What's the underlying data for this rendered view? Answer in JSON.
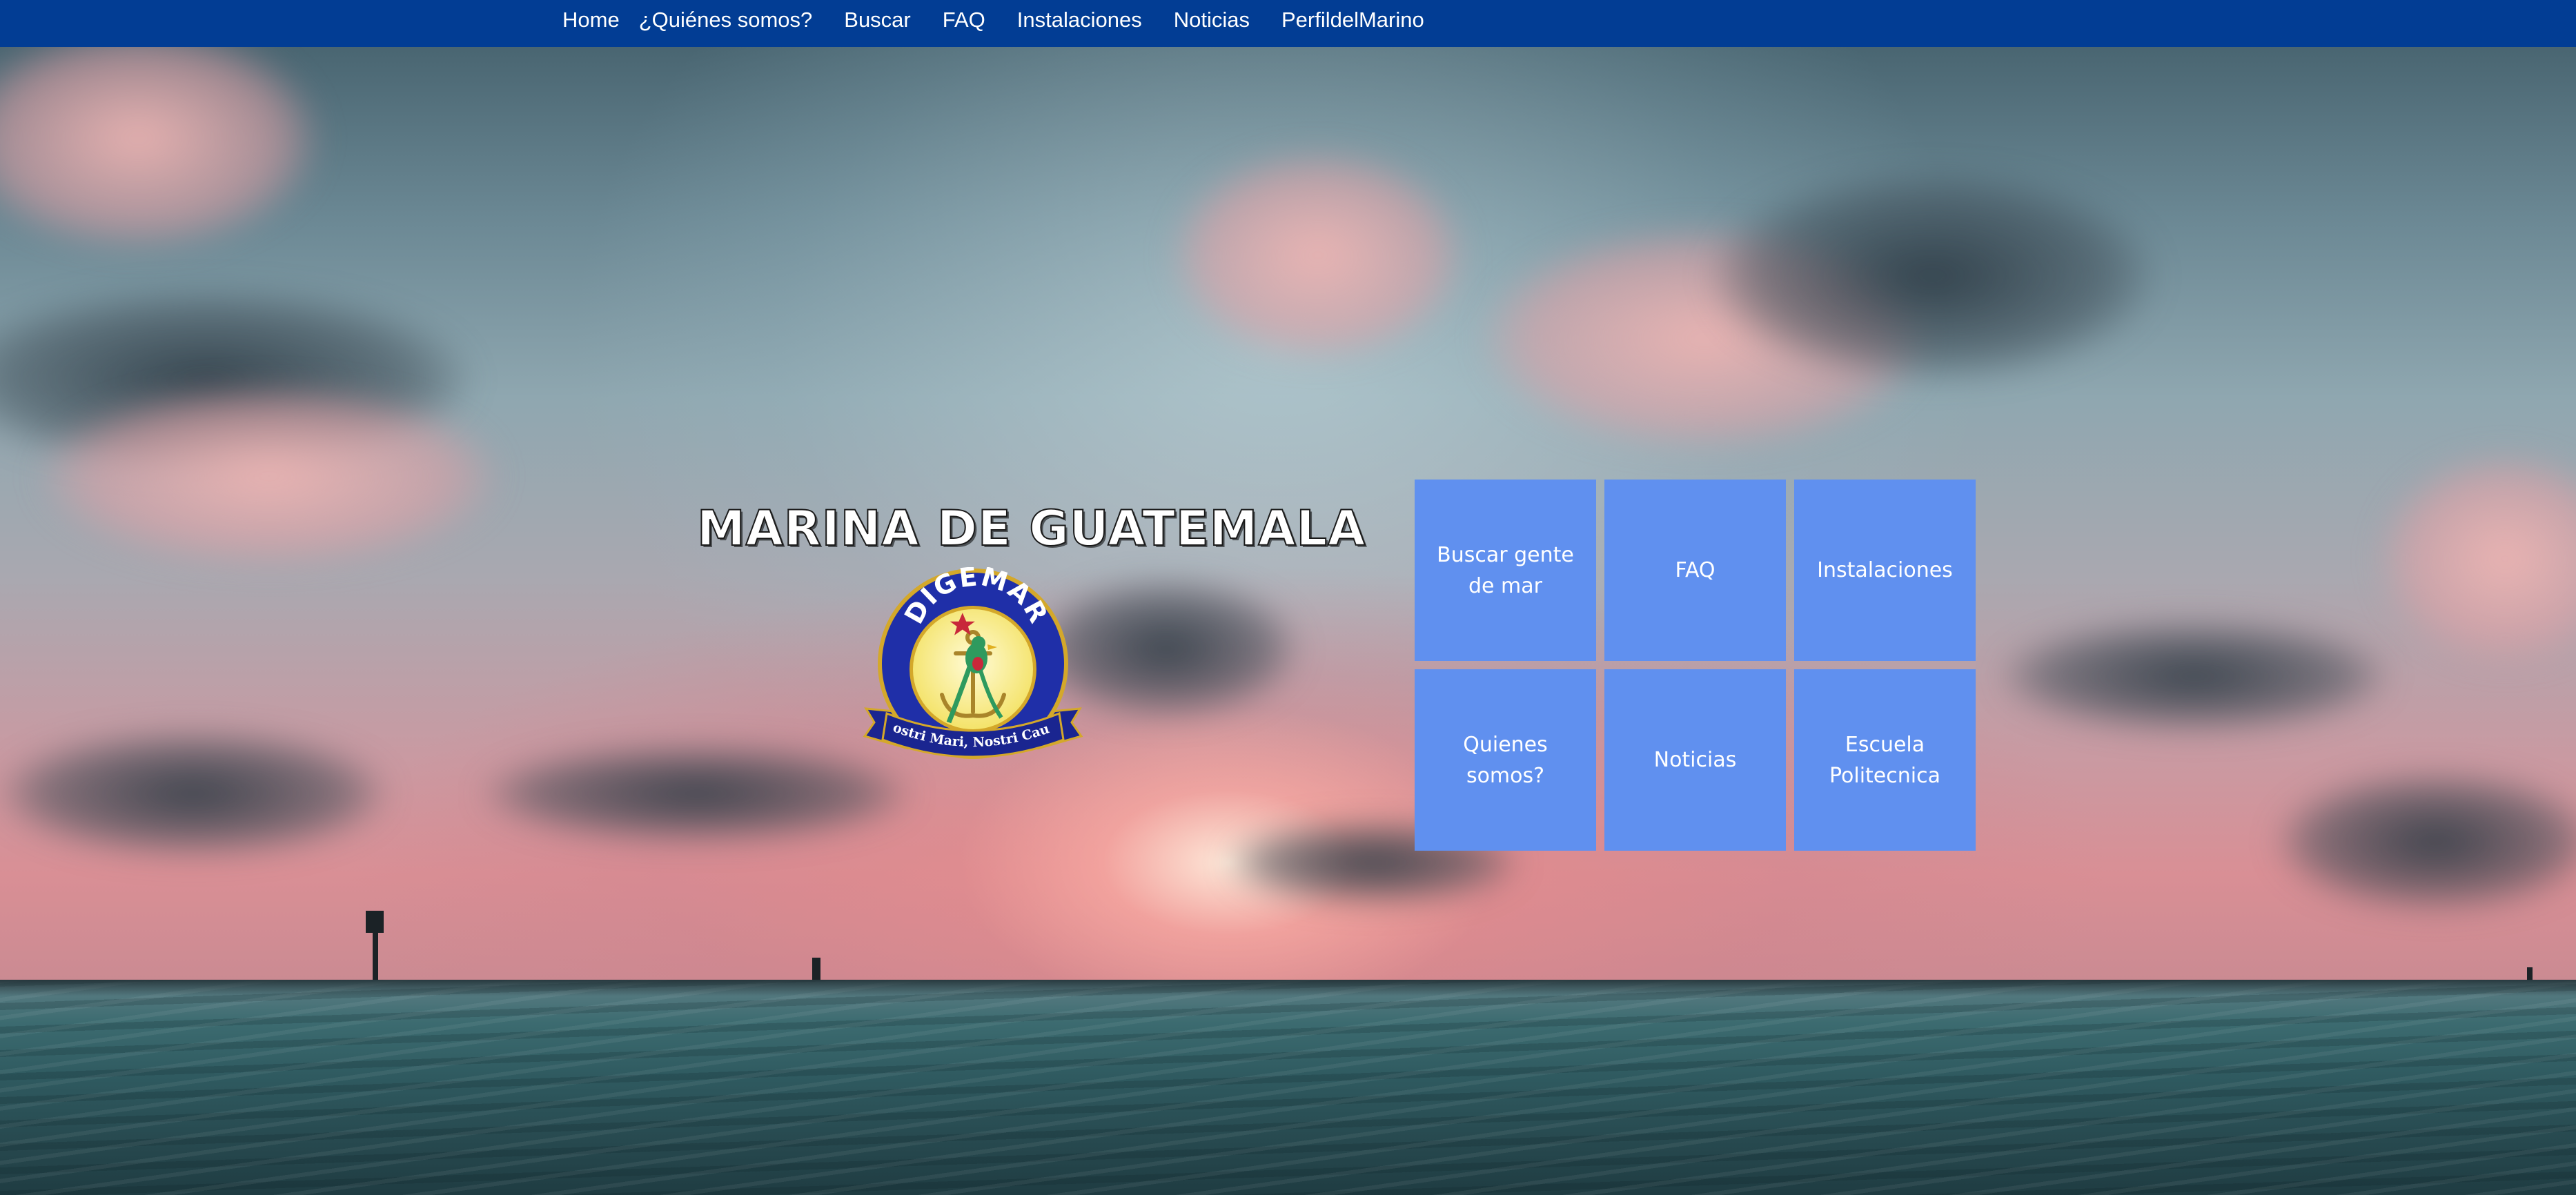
{
  "nav": {
    "items": [
      {
        "label": "Home"
      },
      {
        "label": "¿Quiénes somos?"
      },
      {
        "label": "Buscar"
      },
      {
        "label": "FAQ"
      },
      {
        "label": "Instalaciones"
      },
      {
        "label": "Noticias"
      },
      {
        "label": "PerfildelMarino"
      }
    ]
  },
  "hero": {
    "title": "MARINA DE GUATEMALA",
    "logo": {
      "top_text": "DIGEMAR",
      "motto": "Nostri Mari, Nostri Causa"
    }
  },
  "tiles": [
    {
      "label": "Buscar gente de mar"
    },
    {
      "label": "FAQ"
    },
    {
      "label": "Instalaciones"
    },
    {
      "label": "Quienes somos?"
    },
    {
      "label": "Noticias"
    },
    {
      "label": "Escuela Politecnica"
    }
  ],
  "colors": {
    "navbar": "#023d94",
    "tile": "#6090ef",
    "logo_blue": "#1f2fa8",
    "logo_gold": "#d4a82a"
  }
}
